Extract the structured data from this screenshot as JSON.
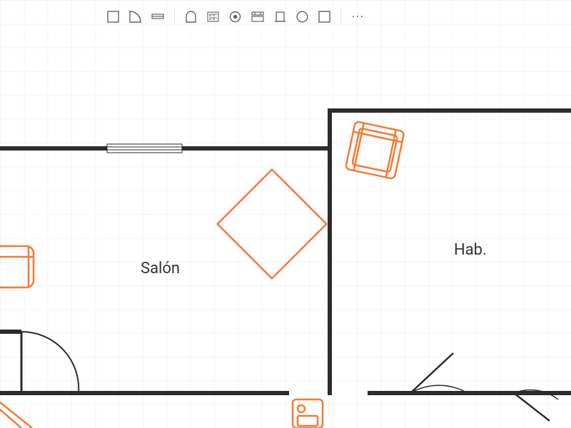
{
  "colors": {
    "wall": "#2d2b2b",
    "accent": "#f47a32",
    "toolbar": "#626262"
  },
  "toolbar": {
    "tools": [
      "wall-tool",
      "corner-tool",
      "floor-tool",
      "arch-tool",
      "kitchen-tool",
      "target-tool",
      "window-tool",
      "door-tool",
      "circle-tool",
      "rect-tool"
    ],
    "more": "⋯"
  },
  "rooms": {
    "salon": {
      "label": "Salón"
    },
    "hab": {
      "label": "Hab."
    }
  }
}
